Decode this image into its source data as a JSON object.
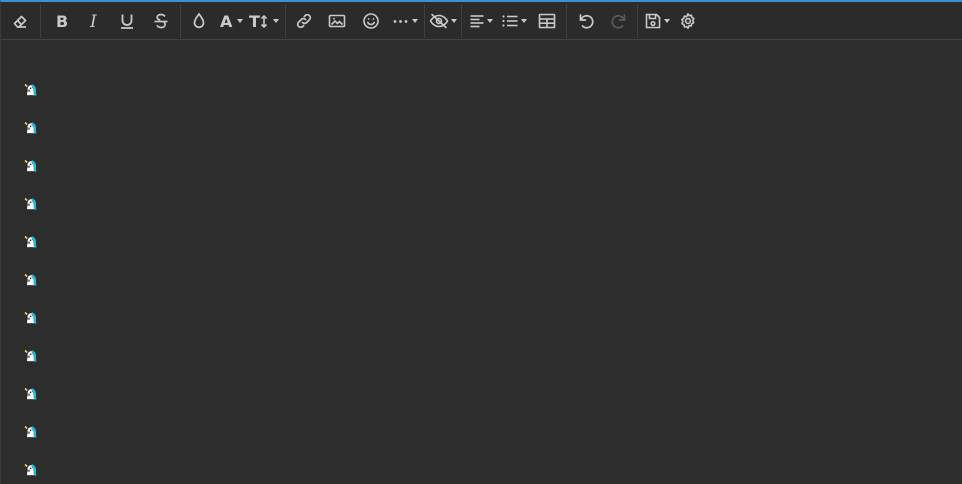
{
  "toolbar": {
    "buttons": [
      {
        "name": "clear-format",
        "icon": "eraser-icon",
        "tooltip": "Clear format"
      },
      {
        "name": "bold",
        "icon": "bold-icon",
        "glyph": "B"
      },
      {
        "name": "italic",
        "icon": "italic-icon",
        "glyph": "I"
      },
      {
        "name": "underline",
        "icon": "underline-icon",
        "glyph": "U"
      },
      {
        "name": "strikethrough",
        "icon": "strikethrough-icon",
        "glyph": "S"
      },
      {
        "name": "color",
        "icon": "droplet-icon"
      },
      {
        "name": "font",
        "icon": "font-icon",
        "glyph": "A"
      },
      {
        "name": "font-size",
        "icon": "text-size-icon",
        "glyph": "T↕"
      },
      {
        "name": "link",
        "icon": "link-icon"
      },
      {
        "name": "image",
        "icon": "image-icon"
      },
      {
        "name": "emoji",
        "icon": "smiley-icon"
      },
      {
        "name": "more",
        "icon": "ellipsis-icon",
        "glyph": "⋯"
      },
      {
        "name": "spoiler",
        "icon": "eye-slash-icon"
      },
      {
        "name": "align",
        "icon": "align-left-icon"
      },
      {
        "name": "list",
        "icon": "list-icon"
      },
      {
        "name": "table",
        "icon": "table-icon"
      },
      {
        "name": "undo",
        "icon": "undo-icon"
      },
      {
        "name": "redo",
        "icon": "redo-icon",
        "disabled": true
      },
      {
        "name": "drafts",
        "icon": "save-icon"
      },
      {
        "name": "settings",
        "icon": "gear-icon"
      }
    ]
  },
  "content": {
    "emoji": "unicorn-emoji",
    "paragraph_count": 11
  },
  "colors": {
    "background": "#2d2d2d",
    "toolbar": "#2b2b2b",
    "icon": "#c9c9c9",
    "accent_border": "#3d8fd6",
    "unicorn_mane": "#29b6d6"
  }
}
